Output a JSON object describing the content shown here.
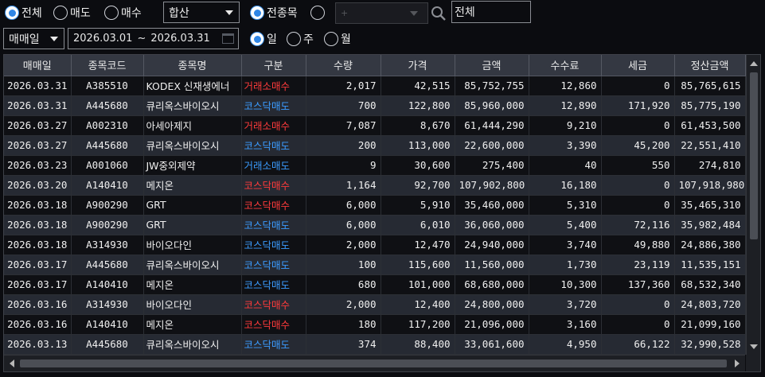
{
  "filters": {
    "trade_type": [
      {
        "label": "전체",
        "selected": true
      },
      {
        "label": "매도",
        "selected": false
      },
      {
        "label": "매수",
        "selected": false
      }
    ],
    "aggregate_select": "합산",
    "stock_scope": [
      {
        "label": "전종목",
        "selected": true
      },
      {
        "label": "",
        "selected": false
      }
    ],
    "stock_code_placeholder": "+",
    "stock_name_value": "전체",
    "date_type_select": "매매일",
    "date_from": "2026.03.01",
    "date_sep": "~",
    "date_to": "2026.03.31",
    "period": [
      {
        "label": "일",
        "selected": true
      },
      {
        "label": "주",
        "selected": false
      },
      {
        "label": "월",
        "selected": false
      }
    ]
  },
  "table": {
    "columns": [
      "매매일",
      "종목코드",
      "종목명",
      "구분",
      "수량",
      "가격",
      "금액",
      "수수료",
      "세금",
      "정산금액"
    ],
    "rows": [
      {
        "date": "2026.03.31",
        "code": "A385510",
        "name": "KODEX 신재생에너",
        "type": "거래소매수",
        "side": "buy",
        "qty": "2,017",
        "price": "42,515",
        "amount": "85,752,755",
        "fee": "12,860",
        "tax": "0",
        "settle": "85,765,615"
      },
      {
        "date": "2026.03.31",
        "code": "A445680",
        "name": "큐리옥스바이오시",
        "type": "코스닥매도",
        "side": "sell",
        "qty": "700",
        "price": "122,800",
        "amount": "85,960,000",
        "fee": "12,890",
        "tax": "171,920",
        "settle": "85,775,190"
      },
      {
        "date": "2026.03.27",
        "code": "A002310",
        "name": "아세아제지",
        "type": "거래소매수",
        "side": "buy",
        "qty": "7,087",
        "price": "8,670",
        "amount": "61,444,290",
        "fee": "9,210",
        "tax": "0",
        "settle": "61,453,500"
      },
      {
        "date": "2026.03.27",
        "code": "A445680",
        "name": "큐리옥스바이오시",
        "type": "코스닥매도",
        "side": "sell",
        "qty": "200",
        "price": "113,000",
        "amount": "22,600,000",
        "fee": "3,390",
        "tax": "45,200",
        "settle": "22,551,410"
      },
      {
        "date": "2026.03.23",
        "code": "A001060",
        "name": "JW중외제약",
        "type": "거래소매도",
        "side": "sell",
        "qty": "9",
        "price": "30,600",
        "amount": "275,400",
        "fee": "40",
        "tax": "550",
        "settle": "274,810"
      },
      {
        "date": "2026.03.20",
        "code": "A140410",
        "name": "메지온",
        "type": "코스닥매수",
        "side": "buy",
        "qty": "1,164",
        "price": "92,700",
        "amount": "107,902,800",
        "fee": "16,180",
        "tax": "0",
        "settle": "107,918,980"
      },
      {
        "date": "2026.03.18",
        "code": "A900290",
        "name": "GRT",
        "type": "코스닥매수",
        "side": "buy",
        "qty": "6,000",
        "price": "5,910",
        "amount": "35,460,000",
        "fee": "5,310",
        "tax": "0",
        "settle": "35,465,310"
      },
      {
        "date": "2026.03.18",
        "code": "A900290",
        "name": "GRT",
        "type": "코스닥매도",
        "side": "sell",
        "qty": "6,000",
        "price": "6,010",
        "amount": "36,060,000",
        "fee": "5,400",
        "tax": "72,116",
        "settle": "35,982,484"
      },
      {
        "date": "2026.03.18",
        "code": "A314930",
        "name": "바이오다인",
        "type": "코스닥매도",
        "side": "sell",
        "qty": "2,000",
        "price": "12,470",
        "amount": "24,940,000",
        "fee": "3,740",
        "tax": "49,880",
        "settle": "24,886,380"
      },
      {
        "date": "2026.03.17",
        "code": "A445680",
        "name": "큐리옥스바이오시",
        "type": "코스닥매도",
        "side": "sell",
        "qty": "100",
        "price": "115,600",
        "amount": "11,560,000",
        "fee": "1,730",
        "tax": "23,119",
        "settle": "11,535,151"
      },
      {
        "date": "2026.03.17",
        "code": "A140410",
        "name": "메지온",
        "type": "코스닥매도",
        "side": "sell",
        "qty": "680",
        "price": "101,000",
        "amount": "68,680,000",
        "fee": "10,300",
        "tax": "137,360",
        "settle": "68,532,340"
      },
      {
        "date": "2026.03.16",
        "code": "A314930",
        "name": "바이오다인",
        "type": "코스닥매수",
        "side": "buy",
        "qty": "2,000",
        "price": "12,400",
        "amount": "24,800,000",
        "fee": "3,720",
        "tax": "0",
        "settle": "24,803,720"
      },
      {
        "date": "2026.03.16",
        "code": "A140410",
        "name": "메지온",
        "type": "코스닥매수",
        "side": "buy",
        "qty": "180",
        "price": "117,200",
        "amount": "21,096,000",
        "fee": "3,160",
        "tax": "0",
        "settle": "21,099,160"
      },
      {
        "date": "2026.03.13",
        "code": "A445680",
        "name": "큐리옥스바이오시",
        "type": "코스닥매도",
        "side": "sell",
        "qty": "374",
        "price": "88,400",
        "amount": "33,061,600",
        "fee": "4,950",
        "tax": "66,122",
        "settle": "32,990,528"
      }
    ]
  },
  "colors": {
    "buy": "#ff3b3b",
    "sell": "#3b9cff",
    "radio_accent": "#2f86e6",
    "background": "#0b0c10",
    "header_bg": "#343842",
    "row_alt_bg": "#262a33"
  }
}
